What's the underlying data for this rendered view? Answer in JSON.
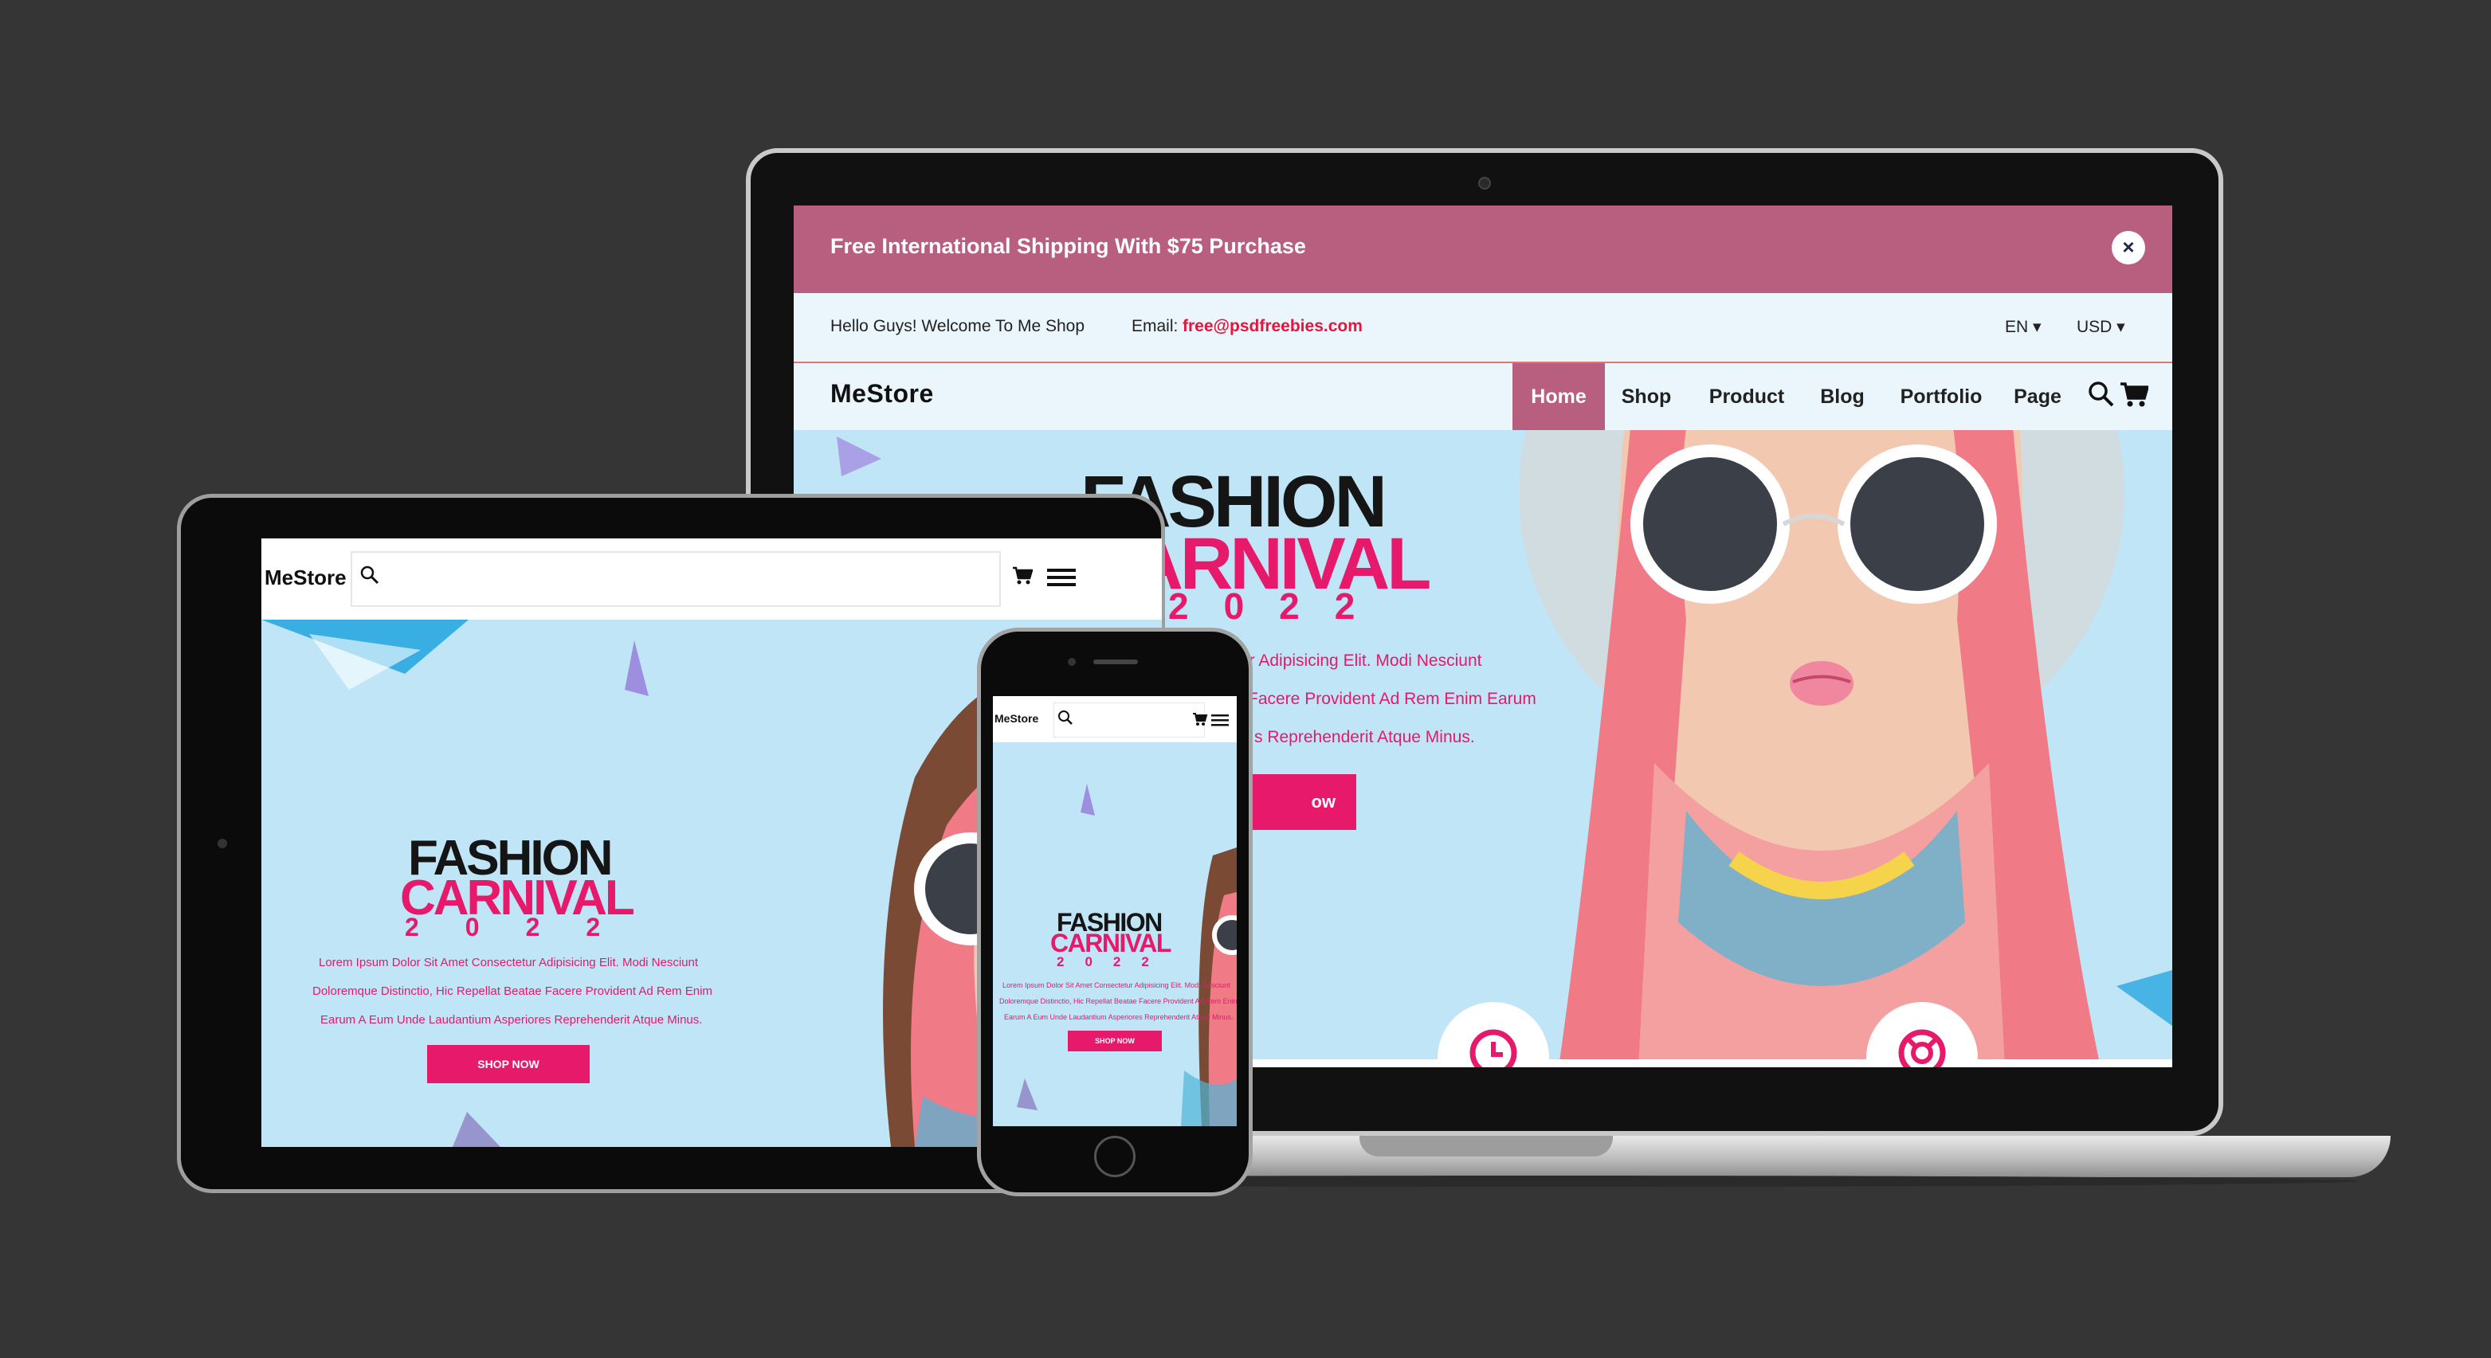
{
  "brand": "MeStore",
  "desktop": {
    "promo": {
      "text": "Free International Shipping With $75 Purchase",
      "close": "×"
    },
    "top_bar": {
      "welcome": "Hello Guys! Welcome To Me Shop",
      "email_label": "Email:",
      "email_value": "free@psdfreebies.com",
      "language": "EN ▾",
      "currency": "USD ▾"
    },
    "nav": [
      "Home",
      "Shop",
      "Product",
      "Blog",
      "Portfolio",
      "Page"
    ],
    "hero": {
      "title_1": "FASHION",
      "title_2": "CARNIVAL",
      "year": "2022",
      "line_1": "ur Adipisicing Elit. Modi Nesciunt",
      "line_2": "Facere Provident Ad Rem Enim Earum",
      "line_3": "s Reprehenderit Atque Minus.",
      "button": "ow"
    }
  },
  "tablet": {
    "title_1": "FASHION",
    "title_2": "CARNIVAL",
    "year": "2022",
    "line_1": "Lorem Ipsum Dolor Sit Amet Consectetur Adipisicing Elit. Modi Nesciunt",
    "line_2": "Doloremque Distinctio, Hic Repellat Beatae Facere Provident Ad Rem Enim",
    "line_3": "Earum A Eum Unde Laudantium Asperiores Reprehenderit Atque Minus.",
    "button": "SHOP NOW"
  },
  "phone": {
    "title_1": "FASHION",
    "title_2": "CARNIVAL",
    "year": "2022",
    "line_1": "Lorem Ipsum Dolor Sit Amet Consectetur Adipisicing Elit. Modi Nesciunt",
    "line_2": "Doloremque Distinctio, Hic Repellat Beatae Facere Provident Ad Rem Enim",
    "line_3": "Earum A Eum Unde Laudantium Asperiores Reprehenderit Atque Minus.",
    "button": "SHOP NOW"
  },
  "icons": [
    "search-icon",
    "cart-icon",
    "menu-icon",
    "close-icon",
    "clock-icon",
    "lifebuoy-icon",
    "chevron-down-icon"
  ],
  "colors": {
    "accent": "#e6196a",
    "promo": "#b85f7f",
    "hero_bg": "#bfe5f7",
    "device": "#0b0b0b",
    "backdrop": "#353535"
  }
}
